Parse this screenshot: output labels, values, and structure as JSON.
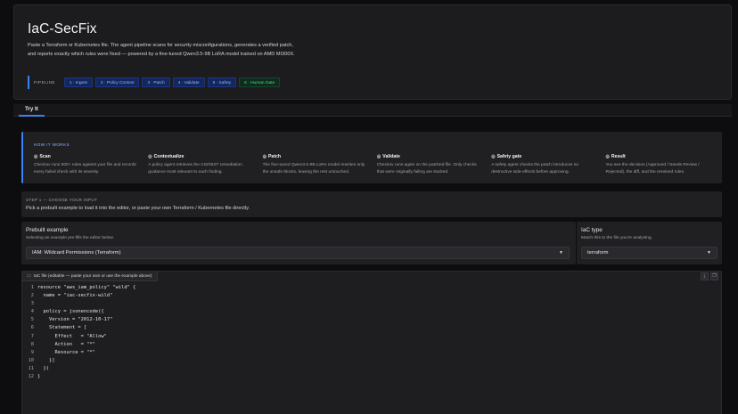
{
  "app": {
    "title": "IaC-SecFix",
    "description": "Paste a Terraform or Kubernetes file. The agent pipeline scans for security misconfigurations, generates a verified patch, and reports exactly which rules were fixed — powered by a fine-tuned Qwen3.5-9B LoRA model trained on AMD MI300X."
  },
  "pipeline": {
    "label": "PIPELINE",
    "chips": [
      {
        "label": "1 · Ingest"
      },
      {
        "label": "2 · Policy Context"
      },
      {
        "label": "3 · Patch"
      },
      {
        "label": "4 · Validate"
      },
      {
        "label": "5 · Safety"
      },
      {
        "label": "6 · Human Gate"
      }
    ],
    "accent": "#3b82f6",
    "final_color": "#4ade80"
  },
  "tabs": [
    {
      "label": "Try It"
    }
  ],
  "how_it_works": {
    "label": "HOW IT WORKS",
    "steps": [
      {
        "icon": "scan-icon",
        "title": "Scan",
        "desc": "Checkov runs 500+ rules against your file and records every failed check with its severity."
      },
      {
        "icon": "contextualize-icon",
        "title": "Contextualize",
        "desc": "A policy agent retrieves the CIS/NIST remediation guidance most relevant to each finding."
      },
      {
        "icon": "patch-icon",
        "title": "Patch",
        "desc": "The fine-tuned Qwen3.5-9B LoRA model rewrites only the unsafe blocks, leaving the rest untouched."
      },
      {
        "icon": "validate-icon",
        "title": "Validate",
        "desc": "Checkov runs again on the patched file. Only checks that were originally failing are tracked."
      },
      {
        "icon": "safety-gate-icon",
        "title": "Safety gate",
        "desc": "A safety agent checks the patch introduces no destructive side-effects before approving."
      },
      {
        "icon": "result-icon",
        "title": "Result",
        "desc": "You see the decision (Approved / Needs Review / Rejected), the diff, and the resolved rules."
      }
    ]
  },
  "step1": {
    "label": "STEP 1 — CHOOSE YOUR INPUT",
    "text": "Pick a prebuilt example to load it into the editor, or paste your own Terraform / Kubernetes file directly."
  },
  "prebuilt": {
    "label": "Prebuilt example",
    "sub": "Selecting an example pre-fills the editor below.",
    "value": "IAM: Wildcard Permissions (Terraform)"
  },
  "iac_type": {
    "label": "IaC type",
    "sub": "Match this to the file you're analysing.",
    "value": "terraform"
  },
  "editor": {
    "tab_label": "IaC file (editable — paste your own or use the example above)",
    "lines": [
      {
        "n": "1",
        "t": "resource \"aws_iam_policy\" \"wild\" {"
      },
      {
        "n": "2",
        "t": "  name = \"iac-secfix-wild\""
      },
      {
        "n": "3",
        "t": ""
      },
      {
        "n": "4",
        "t": "  policy = jsonencode({"
      },
      {
        "n": "5",
        "t": "    Version = \"2012-10-17\""
      },
      {
        "n": "6",
        "t": "    Statement = ["
      },
      {
        "n": "7",
        "t": "      Effect   = \"Allow\""
      },
      {
        "n": "8",
        "t": "      Action   = \"*\""
      },
      {
        "n": "9",
        "t": "      Resource = \"*\""
      },
      {
        "n": "10",
        "t": "    }]"
      },
      {
        "n": "11",
        "t": "  })"
      },
      {
        "n": "12",
        "t": "}"
      }
    ]
  }
}
